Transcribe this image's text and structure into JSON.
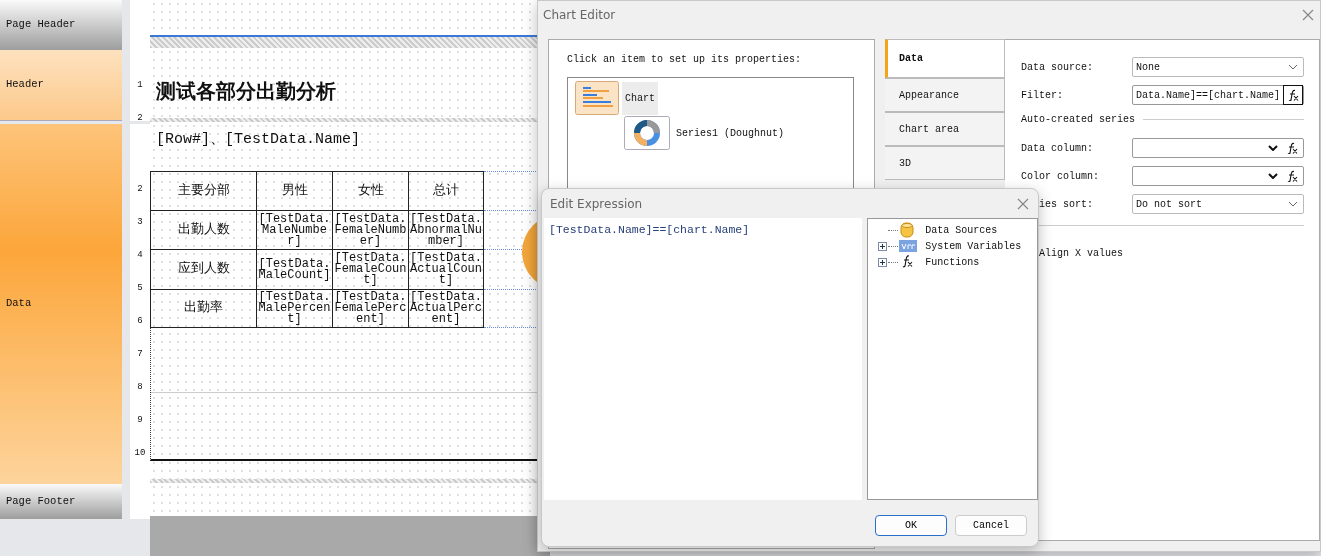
{
  "designer": {
    "bands": [
      {
        "label": "Page Header",
        "kind": "page"
      },
      {
        "label": "Header",
        "kind": "header",
        "ruler": [
          "1",
          "2"
        ]
      },
      {
        "label": "Data",
        "kind": "data",
        "ruler": [
          "2",
          "3",
          "4",
          "5",
          "6",
          "7",
          "8",
          "9",
          "10"
        ]
      },
      {
        "label": "Page Footer",
        "kind": "page"
      }
    ],
    "title": "测试各部分出勤分析",
    "subtitle": "[Row#]、[TestData.Name]",
    "table": {
      "columns": [
        "主要分部",
        "男性",
        "女性",
        "总计"
      ],
      "rows": [
        [
          "出勤人数",
          "[TestData.MaleNumber]",
          "[TestData.FemaleNumber]",
          "[TestData.AbnormalNumber]"
        ],
        [
          "应到人数",
          "[TestData.MaleCount]",
          "[TestData.FemaleCount]",
          "[TestData.ActualCount]"
        ],
        [
          "出勤率",
          "[TestData.MalePercent]",
          "[TestData.FemalePercent]",
          "[TestData.ActualPercent]"
        ]
      ]
    }
  },
  "chart_editor": {
    "title": "Chart Editor",
    "hint": "Click an item to set up its properties:",
    "tree": [
      {
        "label": "Chart",
        "kind": "chart",
        "selected": true,
        "children": [
          {
            "label": "Series1 (Doughnut)",
            "kind": "series",
            "selected": false
          }
        ]
      }
    ],
    "tabs": [
      {
        "label": "Data",
        "selected": true
      },
      {
        "label": "Appearance",
        "selected": false
      },
      {
        "label": "Chart area",
        "selected": false
      },
      {
        "label": "3D",
        "selected": false
      }
    ],
    "fields": [
      {
        "kind": "select",
        "label": "Data source:",
        "value": "None"
      },
      {
        "kind": "expression",
        "label": "Filter:",
        "value": "Data.Name]==[chart.Name]"
      },
      {
        "kind": "section",
        "label": "Auto-created series"
      },
      {
        "kind": "combo",
        "label": "Data column:"
      },
      {
        "kind": "combo",
        "label": "Color column:"
      },
      {
        "kind": "select",
        "label": "ies sort:",
        "value": "Do not sort",
        "partly_hidden": true
      },
      {
        "kind": "divider"
      },
      {
        "kind": "option",
        "label": "Align X values",
        "partly_hidden": true
      }
    ]
  },
  "edit_expression": {
    "title": "Edit Expression",
    "expression": "[TestData.Name]==[chart.Name]",
    "tree": [
      {
        "label": "Data Sources",
        "kind": "datasource",
        "expandable": false
      },
      {
        "label": "System Variables",
        "kind": "variables",
        "expandable": true
      },
      {
        "label": "Functions",
        "kind": "functions",
        "expandable": true
      }
    ],
    "buttons": [
      {
        "label": "OK",
        "focused": true
      },
      {
        "label": "Cancel",
        "focused": false
      }
    ]
  }
}
